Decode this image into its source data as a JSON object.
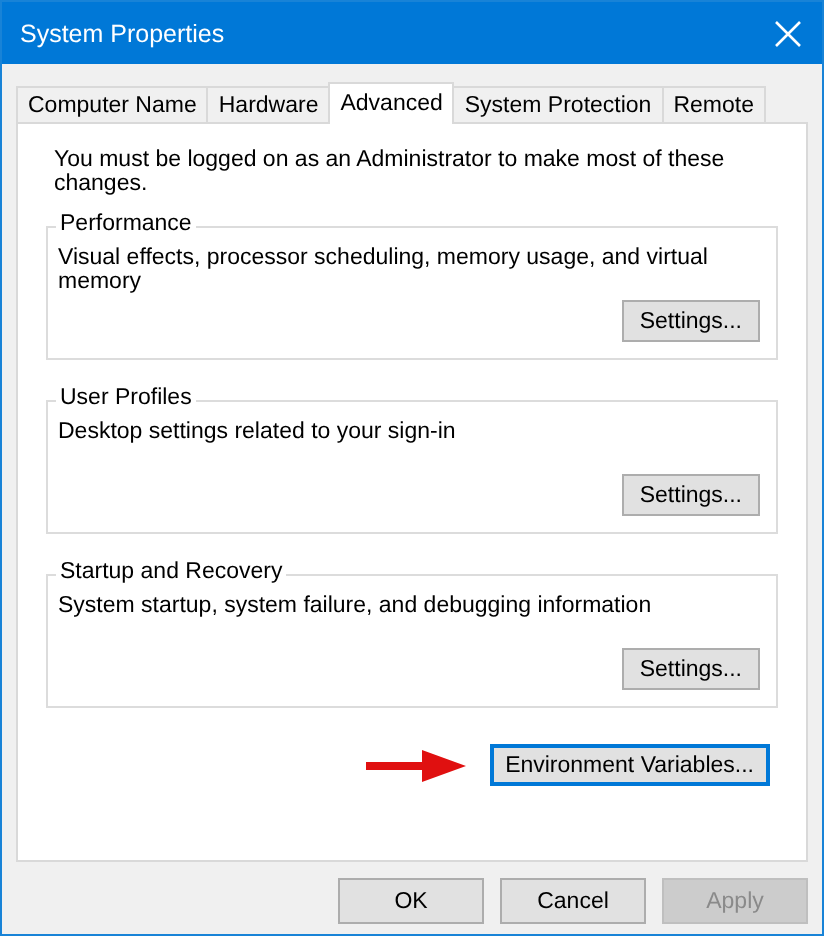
{
  "window": {
    "title": "System Properties"
  },
  "tabs": [
    {
      "label": "Computer Name",
      "selected": false
    },
    {
      "label": "Hardware",
      "selected": false
    },
    {
      "label": "Advanced",
      "selected": true
    },
    {
      "label": "System Protection",
      "selected": false
    },
    {
      "label": "Remote",
      "selected": false
    }
  ],
  "notice": "You must be logged on as an Administrator to make most of these changes.",
  "groups": [
    {
      "title": "Performance",
      "description": "Visual effects, processor scheduling, memory usage, and virtual memory",
      "button": "Settings..."
    },
    {
      "title": "User Profiles",
      "description": "Desktop settings related to your sign-in",
      "button": "Settings..."
    },
    {
      "title": "Startup and Recovery",
      "description": "System startup, system failure, and debugging information",
      "button": "Settings..."
    }
  ],
  "environment_button": {
    "label": "Environment Variables...",
    "focused": true
  },
  "buttons": [
    {
      "label": "OK",
      "disabled": false
    },
    {
      "label": "Cancel",
      "disabled": false
    },
    {
      "label": "Apply",
      "disabled": true
    }
  ]
}
